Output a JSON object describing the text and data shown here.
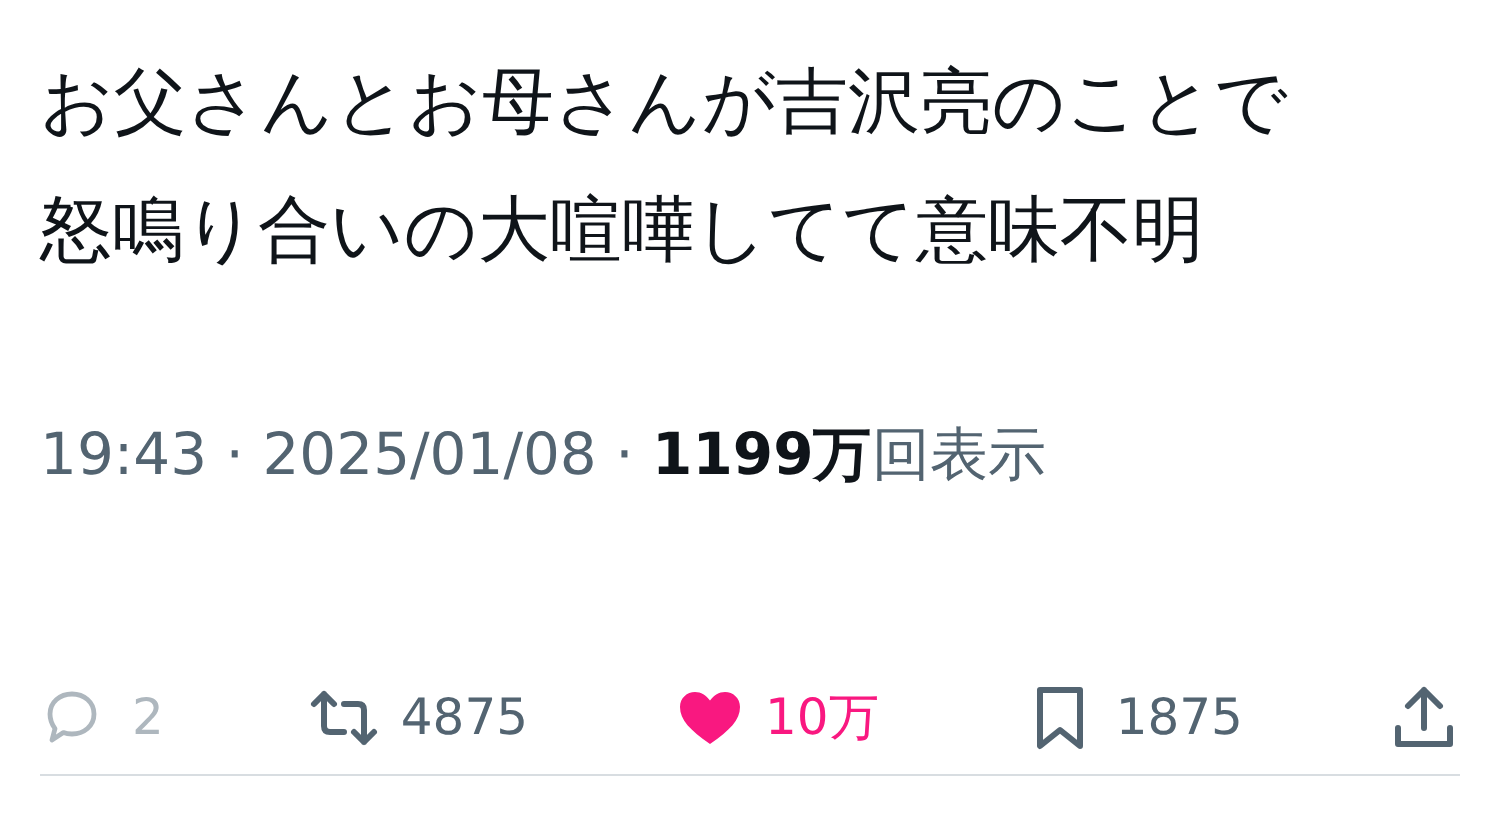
{
  "tweet": {
    "text_lines": [
      "お父さんとお母さんが吉沢亮のことで",
      "怒鳴り合いの大喧嘩してて意味不明"
    ],
    "meta": "19:43 · 2025/01/08 · **1199万**回表示",
    "actions": [
      {
        "kind": "reply",
        "count": "2",
        "selected": false,
        "disabled": true
      },
      {
        "kind": "retweet",
        "count": "4875",
        "selected": false,
        "disabled": false
      },
      {
        "kind": "like",
        "count": "10万",
        "selected": true,
        "disabled": false
      },
      {
        "kind": "bookmark",
        "count": "1875",
        "selected": false,
        "disabled": false
      },
      {
        "kind": "share",
        "selected": false,
        "disabled": false
      }
    ]
  }
}
